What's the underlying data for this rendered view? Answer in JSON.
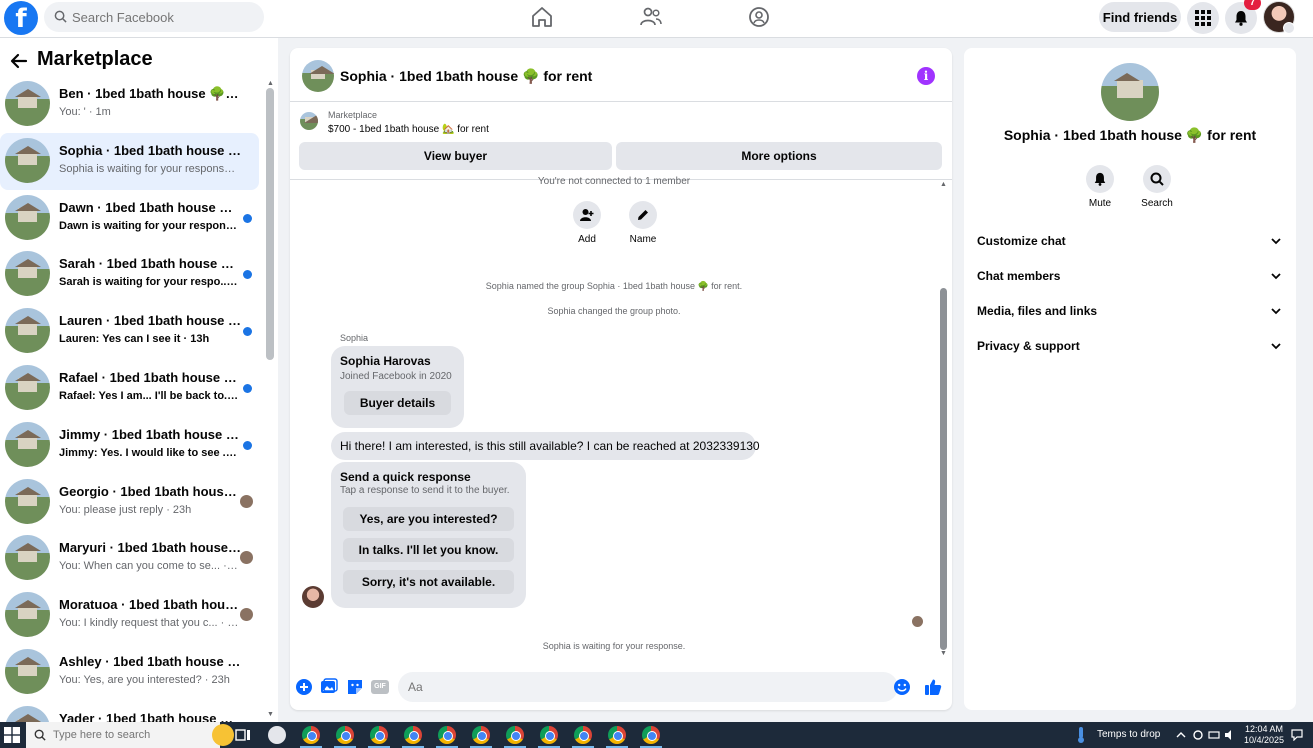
{
  "topbar": {
    "logo": "f",
    "search_placeholder": "Search Facebook",
    "find_friends": "Find friends",
    "notification_count": "7"
  },
  "marketplace": {
    "title": "Marketplace",
    "conversations": [
      {
        "name": "Ben · 1bed 1bath house 🌳 for re...",
        "preview": "You: ' · 1m",
        "indicator": "none"
      },
      {
        "name": "Sophia · 1bed 1bath house 🌳 fo...",
        "preview": "Sophia is waiting for your response. · 8h",
        "indicator": "none"
      },
      {
        "name": "Dawn · 1bed 1bath house 🌳 f...",
        "preview": "Dawn is waiting for your respon... · 8h",
        "indicator": "unread"
      },
      {
        "name": "Sarah · 1bed 1bath house 🌳 fo...",
        "preview": "Sarah is waiting for your respo... · 11h",
        "indicator": "unread"
      },
      {
        "name": "Lauren · 1bed 1bath house 🌳 f...",
        "preview": "Lauren: Yes can I see it · 13h",
        "indicator": "unread"
      },
      {
        "name": "Rafael · 1bed 1bath house 🌳 f...",
        "preview": "Rafael: Yes I am... I'll be back to... · 21h",
        "indicator": "unread"
      },
      {
        "name": "Jimmy · 1bed 1bath house 🌳 f...",
        "preview": "Jimmy: Yes. I would like to see ... · 21h",
        "indicator": "unread"
      },
      {
        "name": "Georgio · 1bed 1bath house ...",
        "preview": "You: please just reply · 23h",
        "indicator": "seen"
      },
      {
        "name": "Maryuri · 1bed 1bath house ...",
        "preview": "You: When can you come to se... · 23h",
        "indicator": "seen"
      },
      {
        "name": "Moratuoa · 1bed 1bath house ...",
        "preview": "You: I kindly request that you c... · 23h",
        "indicator": "seen"
      },
      {
        "name": "Ashley · 1bed 1bath house 🌳 for...",
        "preview": "You: Yes, are you interested? · 23h",
        "indicator": "none"
      },
      {
        "name": "Yader · 1bed 1bath house 🌳 f...",
        "preview": "",
        "indicator": "none"
      }
    ]
  },
  "chat": {
    "title": "Sophia · 1bed 1bath house 🌳 for rent",
    "listing_label": "Marketplace",
    "listing_price": "$700 - 1bed 1bath house 🏡 for rent",
    "view_buyer": "View buyer",
    "more_options": "More options",
    "not_connected": "You're not connected to 1 member",
    "add_label": "Add",
    "name_label": "Name",
    "sys_named": "Sophia named the group Sophia · 1bed 1bath house 🌳 for rent.",
    "sys_photo": "Sophia changed the group photo.",
    "sender": "Sophia",
    "card_name": "Sophia Harovas",
    "card_sub": "Joined Facebook in 2020",
    "buyer_details": "Buyer details",
    "message": "Hi there! I am interested, is this still available? I can be reached at 2032339130",
    "quick_title": "Send a quick response",
    "quick_sub": "Tap a response to send it to the buyer.",
    "quick_options": [
      "Yes, are you interested?",
      "In talks. I'll let you know.",
      "Sorry, it's not available."
    ],
    "waiting": "Sophia is waiting for your response.",
    "composer_placeholder": "Aa",
    "gif_label": "GIF"
  },
  "info": {
    "title": "Sophia · 1bed 1bath house 🌳 for rent",
    "mute": "Mute",
    "search": "Search",
    "sections": [
      "Customize chat",
      "Chat members",
      "Media, files and links",
      "Privacy & support"
    ]
  },
  "taskbar": {
    "search_placeholder": "Type here to search",
    "weather": "Temps to drop",
    "time": "12:04 AM",
    "date": "10/4/2025"
  },
  "colors": {
    "brand": "#1877f2",
    "unread_dot": "#1b74e4",
    "info_purple": "#a033ff",
    "badge_red": "#e41e3f"
  }
}
